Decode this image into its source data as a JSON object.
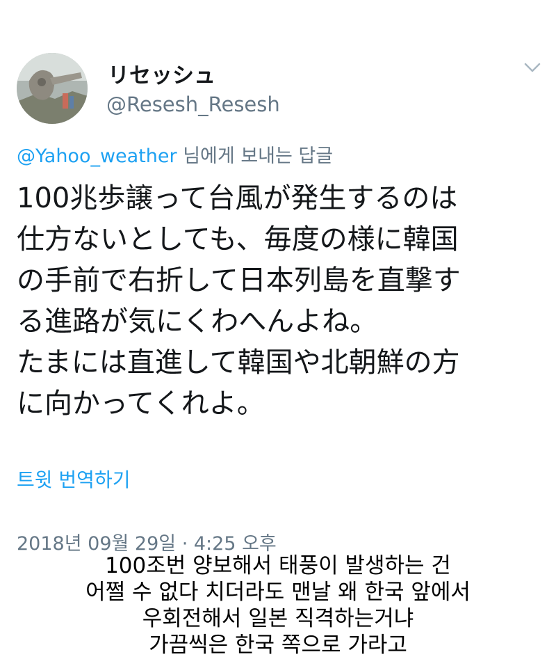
{
  "tweet": {
    "display_name": "リセッシュ",
    "handle": "@Resesh_Resesh",
    "reply_to_handle": "@Yahoo_weather",
    "reply_to_text": "님에게 보내는 답글",
    "body_lines": [
      "100兆歩譲って台風が発生するのは",
      "仕方ないとしても、毎度の様に韓国",
      "の手前で右折して日本列島を直撃す",
      "る進路が気にくわへんよね。",
      "たまには直進して韓国や北朝鮮の方",
      "に向かってくれよ。"
    ],
    "translate_label": "트윗 번역하기",
    "timestamp": "2018년 09월 29일 · 4:25 오후"
  },
  "caption": {
    "lines": [
      "100조번 양보해서 태풍이 발생하는 건",
      "어쩔 수 없다 치더라도 맨날 왜 한국 앞에서",
      "우회전해서 일본 직격하는거냐",
      "가끔씩은 한국 쪽으로 가라고"
    ]
  },
  "icons": {
    "avatar": "avatar-photo",
    "menu": "chevron-down-icon"
  },
  "colors": {
    "link": "#1da1f2",
    "secondary_text": "#657786",
    "primary_text": "#14171a"
  }
}
